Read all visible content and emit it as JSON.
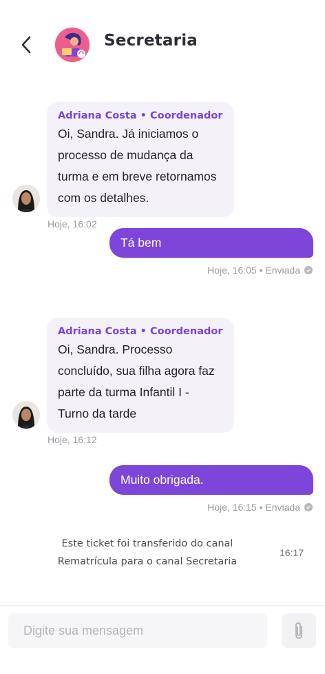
{
  "header": {
    "title": "Secretaria",
    "back_icon": "chevron-left-icon",
    "avatar_color": "#ec5f8c"
  },
  "messages": [
    {
      "direction": "incoming",
      "sender": "Adriana Costa • Coordenador",
      "lines": [
        "Oi, Sandra. Já iniciamos o",
        "processo de mudança da",
        "turma e em breve retornamos",
        "com os detalhes."
      ],
      "time": "Hoje, 16:02"
    },
    {
      "direction": "outgoing",
      "text": "Tá bem",
      "status": "Hoje, 16:05 • Enviada"
    },
    {
      "direction": "incoming",
      "sender": "Adriana Costa • Coordenador",
      "lines": [
        "Oi, Sandra. Processo",
        "concluído, sua filha agora faz",
        "parte da turma Infantil I -",
        "Turno da tarde"
      ],
      "time": "Hoje, 16:12"
    },
    {
      "direction": "outgoing",
      "text": "Muito obrigada.",
      "status": "Hoje, 16:15 • Enviada"
    }
  ],
  "system_notice": {
    "lines": [
      "Este ticket foi transferido do canal",
      "Rematrícula para o canal Secretaria"
    ],
    "time": "16:17"
  },
  "composer": {
    "placeholder": "Digite sua mensagem",
    "value": "",
    "attach_icon": "paperclip-icon"
  },
  "colors": {
    "accent": "#7d45d8",
    "incoming_bubble": "#f4f2f8",
    "sender_name": "#7a44d6"
  }
}
